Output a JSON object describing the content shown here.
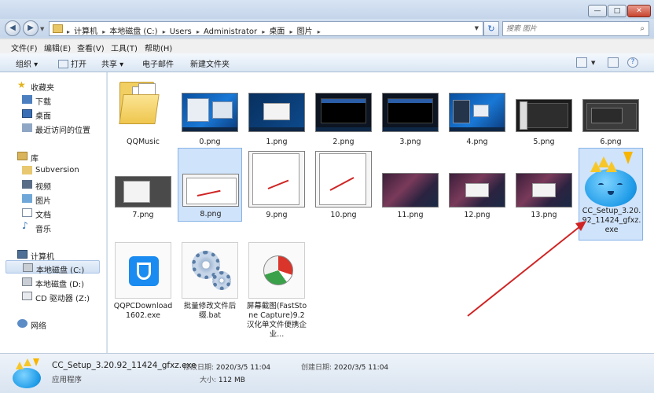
{
  "window": {
    "min_label": "—",
    "max_label": "□",
    "close_label": "✕"
  },
  "address": {
    "crumbs": [
      "计算机",
      "本地磁盘 (C:)",
      "Users",
      "Administrator",
      "桌面",
      "图片"
    ],
    "separator": "▸",
    "refresh_label": "↻"
  },
  "search": {
    "placeholder": "搜索 图片"
  },
  "menu": {
    "items": [
      "文件(F)",
      "编辑(E)",
      "查看(V)",
      "工具(T)",
      "帮助(H)"
    ]
  },
  "toolbar": {
    "organize": "组织 ▾",
    "open": "打开",
    "share": "共享 ▾",
    "email": "电子邮件",
    "new_folder": "新建文件夹"
  },
  "nav": {
    "favorites": "收藏夹",
    "downloads": "下载",
    "desktop": "桌面",
    "recent": "最近访问的位置",
    "libraries": "库",
    "subversion": "Subversion",
    "videos": "视频",
    "pictures": "图片",
    "documents": "文档",
    "music": "音乐",
    "computer": "计算机",
    "drive_c": "本地磁盘 (C:)",
    "drive_d": "本地磁盘 (D:)",
    "drive_z": "CD 驱动器 (Z:)",
    "network": "网络"
  },
  "files": {
    "qqmusic": "QQMusic",
    "f0": "0.png",
    "f1": "1.png",
    "f2": "2.png",
    "f3": "3.png",
    "f4": "4.png",
    "f5": "5.png",
    "f6": "6.png",
    "f7": "7.png",
    "f8": "8.png",
    "f9": "9.png",
    "f10": "10.png",
    "f11": "11.png",
    "f12": "12.png",
    "f13": "13.png",
    "cc_setup": "CC_Setup_3.20.92_11424_gfxz.exe",
    "qqpc": "QQPCDownload1602.exe",
    "batch": "批量修改文件后缀.bat",
    "faststone": "屏幕截图(FastStone Capture)9.2汉化单文件便携企业..."
  },
  "details": {
    "name": "CC_Setup_3.20.92_11424_gfxz.exe",
    "type": "应用程序",
    "modified_label": "修改日期:",
    "modified_value": "2020/3/5 11:04",
    "created_label": "创建日期:",
    "created_value": "2020/3/5 11:04",
    "size_label": "大小:",
    "size_value": "112 MB"
  },
  "colors": {
    "selection": "#cfe3fa",
    "annotation_arrow": "#d02424",
    "window_frame": "#cfdcec"
  }
}
